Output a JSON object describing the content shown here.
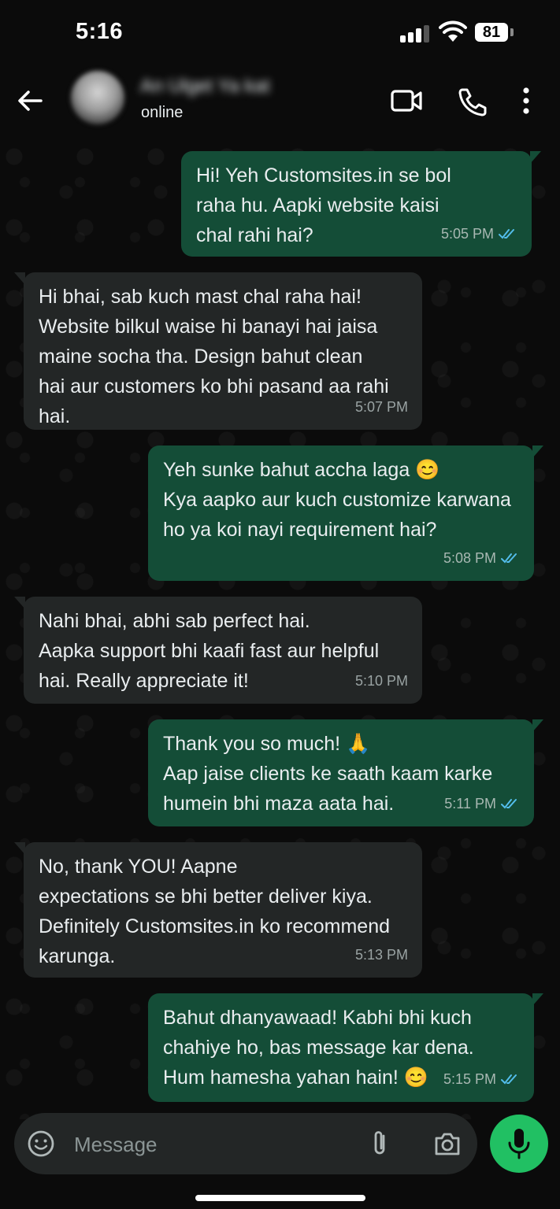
{
  "status_bar": {
    "time": "5:16",
    "battery": "81"
  },
  "header": {
    "contact_name": "An Ulget Ya kat",
    "status": "online",
    "icons": [
      "back-arrow-icon",
      "video-call-icon",
      "phone-icon",
      "more-vert-icon"
    ]
  },
  "messages": [
    {
      "direction": "out",
      "text": "Hi! Yeh Customsites.in se bol\nraha hu. Aapki website kaisi\nchal rahi hai?",
      "time": "5:05 PM",
      "read": true
    },
    {
      "direction": "in",
      "text": "Hi bhai, sab kuch mast chal raha hai!\nWebsite bilkul waise hi banayi hai jaisa\nmaine socha tha. Design bahut clean\nhai aur customers ko bhi pasand aa rahi\nhai.",
      "time": "5:07 PM"
    },
    {
      "direction": "out",
      "text": "Yeh sunke bahut accha laga 😊\nKya aapko aur kuch customize karwana\nho ya koi nayi requirement hai?",
      "time": "5:08 PM",
      "read": true
    },
    {
      "direction": "in",
      "text": "Nahi bhai, abhi sab perfect hai.\nAapka support bhi kaafi fast aur helpful\nhai. Really appreciate it!",
      "time": "5:10 PM"
    },
    {
      "direction": "out",
      "text": "Thank you so much! 🙏\nAap jaise clients ke saath kaam karke\nhumein bhi maza aata hai.",
      "time": "5:11 PM",
      "read": true
    },
    {
      "direction": "in",
      "text": "No, thank YOU! Aapne\nexpectations se bhi better deliver kiya.\nDefinitely Customsites.in ko recommend\nkarunga.",
      "time": "5:13 PM"
    },
    {
      "direction": "out",
      "text": "Bahut dhanyawaad! Kabhi bhi kuch\nchahiye ho, bas message kar dena.\nHum hamesha yahan hain! 😊",
      "time": "5:15 PM",
      "read": true
    }
  ],
  "input": {
    "placeholder": "Message"
  },
  "colors": {
    "outgoing_bubble": "#144d37",
    "incoming_bubble": "#232626",
    "mic_button": "#21c063",
    "read_ticks": "#53bdeb"
  }
}
